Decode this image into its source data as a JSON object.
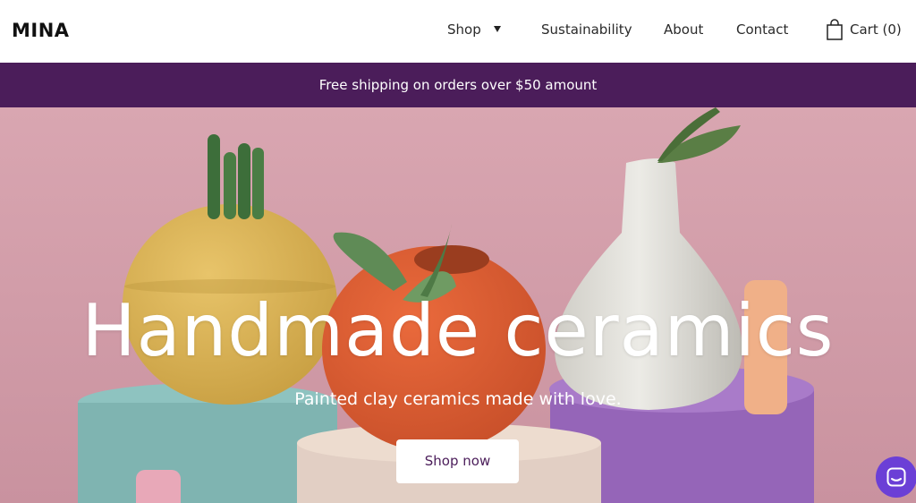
{
  "brand": {
    "logo": "MINA"
  },
  "nav": {
    "shop": "Shop",
    "sustainability": "Sustainability",
    "about": "About",
    "contact": "Contact",
    "cart": "Cart (0)"
  },
  "banner": {
    "text": "Free shipping on orders over $50 amount"
  },
  "hero": {
    "title": "Handmade ceramics",
    "subtitle": "Painted clay ceramics made with love.",
    "cta": "Shop now"
  },
  "icons": {
    "cart": "shopping-bag-icon",
    "caret": "caret-down-icon",
    "chat": "chat-icon"
  },
  "colors": {
    "banner_bg": "#4b1d5a",
    "hero_bg": "#d3a0ab",
    "cta_text": "#4b1d5a",
    "chat_bg": "#6b3fd6"
  }
}
